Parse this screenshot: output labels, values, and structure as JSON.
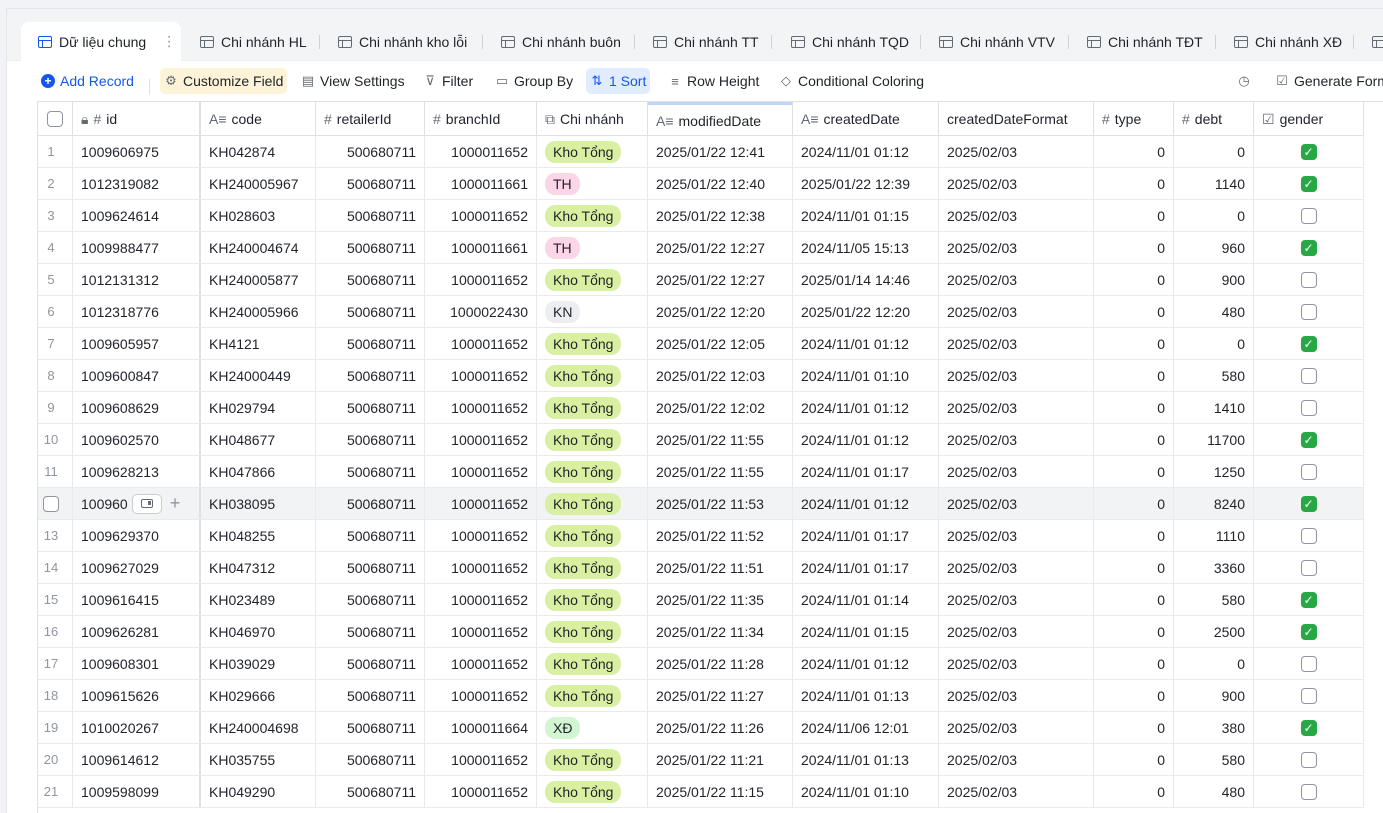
{
  "tabs": [
    {
      "label": "Dữ liệu chung",
      "active": true
    },
    {
      "label": "Chi nhánh HL"
    },
    {
      "label": "Chi nhánh kho lỗi"
    },
    {
      "label": "Chi nhánh buôn"
    },
    {
      "label": "Chi nhánh TT"
    },
    {
      "label": "Chi nhánh TQD"
    },
    {
      "label": "Chi nhánh VTV"
    },
    {
      "label": "Chi nhánh TĐT"
    },
    {
      "label": "Chi nhánh XĐ"
    }
  ],
  "toolbar": {
    "add_record": "Add Record",
    "customize_field": "Customize Field",
    "view_settings": "View Settings",
    "filter": "Filter",
    "group_by": "Group By",
    "sort": "1 Sort",
    "row_height": "Row Height",
    "conditional_coloring": "Conditional Coloring",
    "generate_form": "Generate Form"
  },
  "columns": [
    "id",
    "code",
    "retailerId",
    "branchId",
    "Chi nhánh",
    "modifiedDate",
    "createdDate",
    "createdDateFormat",
    "type",
    "debt",
    "gender"
  ],
  "rows": [
    {
      "n": "1",
      "id": "1009606975",
      "code": "KH042874",
      "retailerId": "500680711",
      "branchId": "1000011652",
      "branch": "Kho Tổng",
      "modified": "2025/01/22 12:41",
      "created": "2024/11/01 01:12",
      "createdFmt": "2025/02/03",
      "type": "0",
      "debt": "0",
      "gender": true
    },
    {
      "n": "2",
      "id": "1012319082",
      "code": "KH240005967",
      "retailerId": "500680711",
      "branchId": "1000011661",
      "branch": "TH",
      "modified": "2025/01/22 12:40",
      "created": "2025/01/22 12:39",
      "createdFmt": "2025/02/03",
      "type": "0",
      "debt": "1140",
      "gender": true
    },
    {
      "n": "3",
      "id": "1009624614",
      "code": "KH028603",
      "retailerId": "500680711",
      "branchId": "1000011652",
      "branch": "Kho Tổng",
      "modified": "2025/01/22 12:38",
      "created": "2024/11/01 01:15",
      "createdFmt": "2025/02/03",
      "type": "0",
      "debt": "0",
      "gender": false
    },
    {
      "n": "4",
      "id": "1009988477",
      "code": "KH240004674",
      "retailerId": "500680711",
      "branchId": "1000011661",
      "branch": "TH",
      "modified": "2025/01/22 12:27",
      "created": "2024/11/05 15:13",
      "createdFmt": "2025/02/03",
      "type": "0",
      "debt": "960",
      "gender": true
    },
    {
      "n": "5",
      "id": "1012131312",
      "code": "KH240005877",
      "retailerId": "500680711",
      "branchId": "1000011652",
      "branch": "Kho Tổng",
      "modified": "2025/01/22 12:27",
      "created": "2025/01/14 14:46",
      "createdFmt": "2025/02/03",
      "type": "0",
      "debt": "900",
      "gender": false
    },
    {
      "n": "6",
      "id": "1012318776",
      "code": "KH240005966",
      "retailerId": "500680711",
      "branchId": "1000022430",
      "branch": "KN",
      "modified": "2025/01/22 12:20",
      "created": "2025/01/22 12:20",
      "createdFmt": "2025/02/03",
      "type": "0",
      "debt": "480",
      "gender": false
    },
    {
      "n": "7",
      "id": "1009605957",
      "code": "KH4121",
      "retailerId": "500680711",
      "branchId": "1000011652",
      "branch": "Kho Tổng",
      "modified": "2025/01/22 12:05",
      "created": "2024/11/01 01:12",
      "createdFmt": "2025/02/03",
      "type": "0",
      "debt": "0",
      "gender": true
    },
    {
      "n": "8",
      "id": "1009600847",
      "code": "KH24000449",
      "retailerId": "500680711",
      "branchId": "1000011652",
      "branch": "Kho Tổng",
      "modified": "2025/01/22 12:03",
      "created": "2024/11/01 01:10",
      "createdFmt": "2025/02/03",
      "type": "0",
      "debt": "580",
      "gender": false
    },
    {
      "n": "9",
      "id": "1009608629",
      "code": "KH029794",
      "retailerId": "500680711",
      "branchId": "1000011652",
      "branch": "Kho Tổng",
      "modified": "2025/01/22 12:02",
      "created": "2024/11/01 01:12",
      "createdFmt": "2025/02/03",
      "type": "0",
      "debt": "1410",
      "gender": false
    },
    {
      "n": "10",
      "id": "1009602570",
      "code": "KH048677",
      "retailerId": "500680711",
      "branchId": "1000011652",
      "branch": "Kho Tổng",
      "modified": "2025/01/22 11:55",
      "created": "2024/11/01 01:12",
      "createdFmt": "2025/02/03",
      "type": "0",
      "debt": "11700",
      "gender": true
    },
    {
      "n": "11",
      "id": "1009628213",
      "code": "KH047866",
      "retailerId": "500680711",
      "branchId": "1000011652",
      "branch": "Kho Tổng",
      "modified": "2025/01/22 11:55",
      "created": "2024/11/01 01:17",
      "createdFmt": "2025/02/03",
      "type": "0",
      "debt": "1250",
      "gender": false
    },
    {
      "n": "",
      "id": "100960\t",
      "code": "KH038095",
      "retailerId": "500680711",
      "branchId": "1000011652",
      "branch": "Kho Tổng",
      "modified": "2025/01/22 11:53",
      "created": "2024/11/01 01:12",
      "createdFmt": "2025/02/03",
      "type": "0",
      "debt": "8240",
      "gender": true,
      "hover": true
    },
    {
      "n": "13",
      "id": "1009629370",
      "code": "KH048255",
      "retailerId": "500680711",
      "branchId": "1000011652",
      "branch": "Kho Tổng",
      "modified": "2025/01/22 11:52",
      "created": "2024/11/01 01:17",
      "createdFmt": "2025/02/03",
      "type": "0",
      "debt": "1110",
      "gender": false
    },
    {
      "n": "14",
      "id": "1009627029",
      "code": "KH047312",
      "retailerId": "500680711",
      "branchId": "1000011652",
      "branch": "Kho Tổng",
      "modified": "2025/01/22 11:51",
      "created": "2024/11/01 01:17",
      "createdFmt": "2025/02/03",
      "type": "0",
      "debt": "3360",
      "gender": false
    },
    {
      "n": "15",
      "id": "1009616415",
      "code": "KH023489",
      "retailerId": "500680711",
      "branchId": "1000011652",
      "branch": "Kho Tổng",
      "modified": "2025/01/22 11:35",
      "created": "2024/11/01 01:14",
      "createdFmt": "2025/02/03",
      "type": "0",
      "debt": "580",
      "gender": true
    },
    {
      "n": "16",
      "id": "1009626281",
      "code": "KH046970",
      "retailerId": "500680711",
      "branchId": "1000011652",
      "branch": "Kho Tổng",
      "modified": "2025/01/22 11:34",
      "created": "2024/11/01 01:15",
      "createdFmt": "2025/02/03",
      "type": "0",
      "debt": "2500",
      "gender": true
    },
    {
      "n": "17",
      "id": "1009608301",
      "code": "KH039029",
      "retailerId": "500680711",
      "branchId": "1000011652",
      "branch": "Kho Tổng",
      "modified": "2025/01/22 11:28",
      "created": "2024/11/01 01:12",
      "createdFmt": "2025/02/03",
      "type": "0",
      "debt": "0",
      "gender": false
    },
    {
      "n": "18",
      "id": "1009615626",
      "code": "KH029666",
      "retailerId": "500680711",
      "branchId": "1000011652",
      "branch": "Kho Tổng",
      "modified": "2025/01/22 11:27",
      "created": "2024/11/01 01:13",
      "createdFmt": "2025/02/03",
      "type": "0",
      "debt": "900",
      "gender": false
    },
    {
      "n": "19",
      "id": "1010020267",
      "code": "KH240004698",
      "retailerId": "500680711",
      "branchId": "1000011664",
      "branch": "XĐ",
      "modified": "2025/01/22 11:26",
      "created": "2024/11/06 12:01",
      "createdFmt": "2025/02/03",
      "type": "0",
      "debt": "380",
      "gender": true
    },
    {
      "n": "20",
      "id": "1009614612",
      "code": "KH035755",
      "retailerId": "500680711",
      "branchId": "1000011652",
      "branch": "Kho Tổng",
      "modified": "2025/01/22 11:21",
      "created": "2024/11/01 01:13",
      "createdFmt": "2025/02/03",
      "type": "0",
      "debt": "580",
      "gender": false
    },
    {
      "n": "21",
      "id": "1009598099",
      "code": "KH049290",
      "retailerId": "500680711",
      "branchId": "1000011652",
      "branch": "Kho Tổng",
      "modified": "2025/01/22 11:15",
      "created": "2024/11/01 01:10",
      "createdFmt": "2025/02/03",
      "type": "0",
      "debt": "480",
      "gender": false
    }
  ],
  "branch_colors": {
    "Kho Tổng": "#d9f0a3",
    "TH": "#fbd5e8",
    "KN": "#eceef1",
    "XĐ": "#d3f5d1"
  },
  "accent": "#1456f0"
}
